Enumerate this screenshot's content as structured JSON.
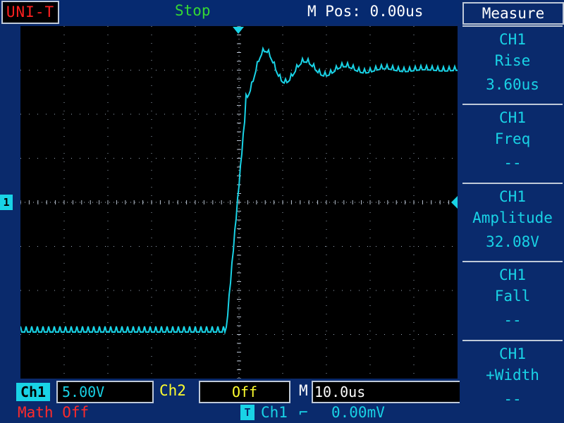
{
  "header": {
    "brand": "UNI-T",
    "status": "Stop",
    "mpos": "M Pos: 0.00us"
  },
  "screen": {
    "ch_marker": "1"
  },
  "channels": {
    "ch1_label": "Ch1",
    "ch1_scale": "5.00V",
    "ch2_label": "Ch2",
    "ch2_value": "Off",
    "timebase_label": "M",
    "timebase_value": "10.0us"
  },
  "math": {
    "status": "Math Off"
  },
  "trigger": {
    "icon": "T",
    "source": "Ch1",
    "edge_symbol": "⌐",
    "level": "0.00mV"
  },
  "menu": {
    "title": "Measure",
    "items": [
      {
        "channel": "CH1",
        "name": "Rise",
        "value": "3.60us"
      },
      {
        "channel": "CH1",
        "name": "Freq",
        "value": "--"
      },
      {
        "channel": "CH1",
        "name": "Amplitude",
        "value": "32.08V"
      },
      {
        "channel": "CH1",
        "name": "Fall",
        "value": "--"
      },
      {
        "channel": "CH1",
        "name": "+Width",
        "value": "--"
      }
    ]
  },
  "colors": {
    "trace": "#19d3e6",
    "background": "#0a2a6c",
    "status": "#34d834",
    "brand": "#ff2020",
    "ch2": "#ffff2e"
  }
}
